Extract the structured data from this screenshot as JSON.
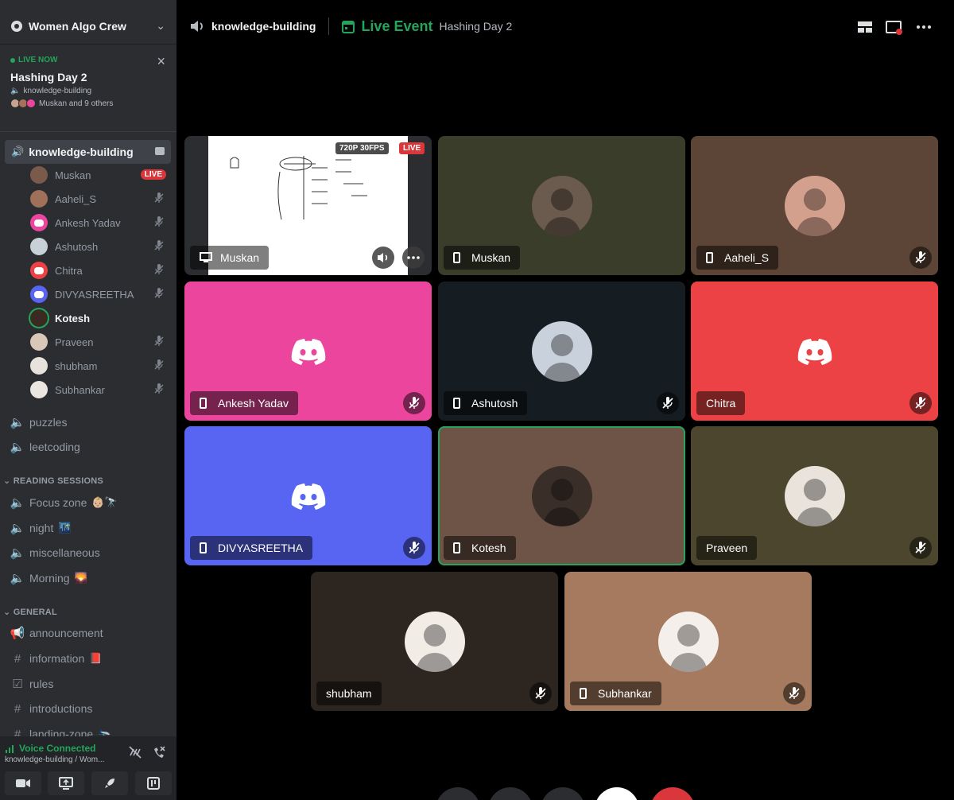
{
  "server": {
    "name": "Women Algo Crew"
  },
  "live_card": {
    "badge": "LIVE NOW",
    "title": "Hashing Day 2",
    "channel": "knowledge-building",
    "members_text": "Muskan and 9 others"
  },
  "sidebar": {
    "active_channel": "knowledge-building",
    "members": [
      {
        "name": "Muskan",
        "live": "LIVE"
      },
      {
        "name": "Aaheli_S"
      },
      {
        "name": "Ankesh Yadav"
      },
      {
        "name": "Ashutosh"
      },
      {
        "name": "Chitra"
      },
      {
        "name": "DIVYASREETHA"
      },
      {
        "name": "Kotesh"
      },
      {
        "name": "Praveen"
      },
      {
        "name": "shubham"
      },
      {
        "name": "Subhankar"
      }
    ],
    "voice_channels": [
      "puzzles",
      "leetcoding"
    ],
    "category_reading": "READING SESSIONS",
    "reading_channels": [
      "Focus zone",
      "night",
      "miscellaneous",
      "Morning"
    ],
    "reading_emojis": [
      "👶🏼🔭",
      "🌃",
      "",
      "🌄"
    ],
    "category_general": "GENERAL",
    "general_channels": [
      "announcement",
      "information",
      "rules",
      "introductions",
      "landing-zone"
    ],
    "general_emojis": [
      "",
      "📕",
      "",
      "",
      "🛬"
    ]
  },
  "voice_panel": {
    "status": "Voice Connected",
    "sub": "knowledge-building / Wom..."
  },
  "topbar": {
    "channel": "knowledge-building",
    "live_event": "Live Event",
    "event_name": "Hashing Day 2"
  },
  "stream": {
    "quality": "720P 30FPS",
    "live": "LIVE",
    "user": "Muskan"
  },
  "tiles": [
    {
      "name": "Muskan",
      "bg": "#3a3d2a",
      "kind": "photo"
    },
    {
      "name": "Aaheli_S",
      "bg": "#5c4536",
      "kind": "photo"
    },
    {
      "name": "Ankesh Yadav",
      "bg": "#eb459e",
      "kind": "discord"
    },
    {
      "name": "Ashutosh",
      "bg": "#151c22",
      "kind": "photo"
    },
    {
      "name": "Chitra",
      "bg": "#ed4245",
      "kind": "discord"
    },
    {
      "name": "DIVYASREETHA",
      "bg": "#5865f2",
      "kind": "discord"
    },
    {
      "name": "Kotesh",
      "bg": "#6e5446",
      "kind": "photo"
    },
    {
      "name": "Praveen",
      "bg": "#4c462e",
      "kind": "photo"
    },
    {
      "name": "shubham",
      "bg": "#2d2520",
      "kind": "photo"
    },
    {
      "name": "Subhankar",
      "bg": "#a57a5e",
      "kind": "photo"
    }
  ],
  "colors": {
    "sidebar": "#2b2d31",
    "green": "#23a55a",
    "red": "#da373c"
  }
}
